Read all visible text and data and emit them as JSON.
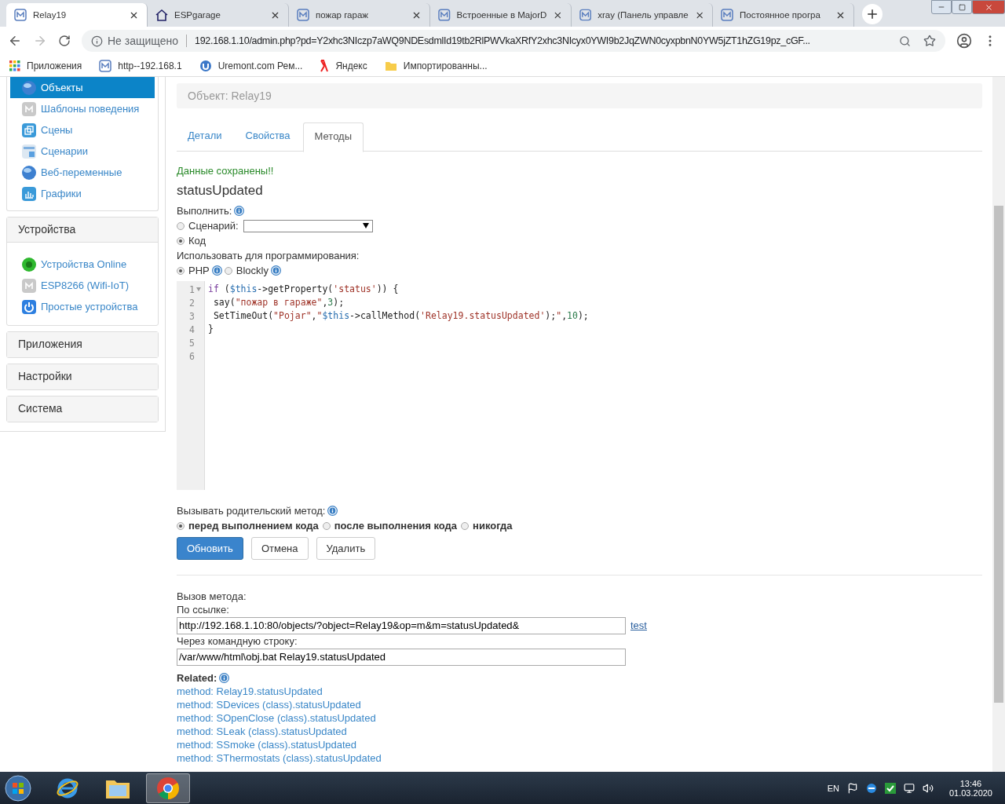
{
  "browser": {
    "tabs": [
      {
        "title": "Relay19",
        "kind": "m",
        "selected": true
      },
      {
        "title": "ESPgarage",
        "kind": "home",
        "selected": false
      },
      {
        "title": "пожар гараж",
        "kind": "m",
        "selected": false
      },
      {
        "title": "Встроенные в MajorD",
        "kind": "m",
        "selected": false
      },
      {
        "title": "xray (Панель управле",
        "kind": "m",
        "selected": false
      },
      {
        "title": "Постоянное програ",
        "kind": "m",
        "selected": false
      }
    ],
    "security": "Не защищено",
    "url": "192.168.1.10/admin.php?pd=Y2xhc3NIczp7aWQ9NDEsdmlId19tb2RlPWVkaXRfY2xhc3NIcyx0YWI9b2JqZWN0cyxpbnN0YW5jZT1hZG19pz_cGF...",
    "bookmarks": [
      {
        "label": "Приложения",
        "kind": "apps"
      },
      {
        "label": "http--192.168.1",
        "kind": "m"
      },
      {
        "label": "Uremont.com  Рем...",
        "kind": "uremont"
      },
      {
        "label": "Яндекс",
        "kind": "yandex"
      },
      {
        "label": "Импортированны...",
        "kind": "folder"
      }
    ]
  },
  "sidebar": {
    "items": [
      {
        "label": "Объекты",
        "kind": "globe",
        "selected": true
      },
      {
        "label": "Шаблоны поведения",
        "kind": "template",
        "selected": false
      },
      {
        "label": "Сцены",
        "kind": "scenes",
        "selected": false
      },
      {
        "label": "Сценарии",
        "kind": "scripts",
        "selected": false
      },
      {
        "label": "Веб-переменные",
        "kind": "globe",
        "selected": false
      },
      {
        "label": "Графики",
        "kind": "charts",
        "selected": false
      }
    ],
    "sections": [
      {
        "title": "Устройства",
        "items": [
          {
            "label": "Устройства Online",
            "kind": "online",
            "selected": false
          },
          {
            "label": "ESP8266 (Wifi-IoT)",
            "kind": "template",
            "selected": false
          },
          {
            "label": "Простые устройства",
            "kind": "power",
            "selected": false
          }
        ]
      },
      {
        "title": "Приложения"
      },
      {
        "title": "Настройки"
      },
      {
        "title": "Система"
      }
    ]
  },
  "main": {
    "object_label": "Объект: Relay19",
    "tabs": [
      {
        "label": "Детали",
        "selected": false
      },
      {
        "label": "Свойства",
        "selected": false
      },
      {
        "label": "Методы",
        "selected": true
      }
    ],
    "message": "Данные сохранены!!",
    "method_name": "statusUpdated",
    "execute_label": "Выполнить:",
    "execute_options": [
      {
        "label": "Сценарий:",
        "kind": "select",
        "selected": false
      },
      {
        "label": "Код",
        "kind": "plain",
        "selected": true
      }
    ],
    "programming_label": "Использовать для программирования:",
    "languages": [
      {
        "label": "PHP",
        "selected": true
      },
      {
        "label": "Blockly",
        "selected": false
      }
    ],
    "code": [
      {
        "number": "1",
        "foldable": true,
        "tokens": [
          {
            "kind": "kw",
            "t": "if"
          },
          {
            "kind": "p",
            "t": " ("
          },
          {
            "kind": "var",
            "t": "$this"
          },
          {
            "kind": "p",
            "t": "->getProperty("
          },
          {
            "kind": "str",
            "t": "'status'"
          },
          {
            "kind": "p",
            "t": ")) {"
          }
        ]
      },
      {
        "number": "2",
        "foldable": false,
        "tokens": [
          {
            "kind": "p",
            "t": " say("
          },
          {
            "kind": "str",
            "t": "\"пожар в гараже\""
          },
          {
            "kind": "p",
            "t": ","
          },
          {
            "kind": "num",
            "t": "3"
          },
          {
            "kind": "p",
            "t": ");"
          }
        ]
      },
      {
        "number": "3",
        "foldable": false,
        "tokens": [
          {
            "kind": "p",
            "t": " SetTimeOut("
          },
          {
            "kind": "str",
            "t": "\"Pojar\""
          },
          {
            "kind": "p",
            "t": ","
          },
          {
            "kind": "str",
            "t": "\""
          },
          {
            "kind": "var",
            "t": "$this"
          },
          {
            "kind": "p",
            "t": "->callMethod("
          },
          {
            "kind": "str",
            "t": "'Relay19.statusUpdated'"
          },
          {
            "kind": "p",
            "t": ");"
          },
          {
            "kind": "str",
            "t": "\""
          },
          {
            "kind": "p",
            "t": ","
          },
          {
            "kind": "num",
            "t": "10"
          },
          {
            "kind": "p",
            "t": ");"
          }
        ]
      },
      {
        "number": "4",
        "foldable": false,
        "tokens": [
          {
            "kind": "p",
            "t": "}"
          }
        ]
      },
      {
        "number": "5",
        "foldable": false
      },
      {
        "number": "6",
        "foldable": false
      }
    ],
    "parent_label": "Вызывать родительский метод:",
    "parent_options": [
      {
        "label": "перед выполнением кода",
        "selected": true
      },
      {
        "label": "после выполнения кода",
        "selected": false
      },
      {
        "label": "никогда",
        "selected": false
      }
    ],
    "buttons": [
      {
        "label": "Обновить",
        "kind": "primary"
      },
      {
        "label": "Отмена",
        "kind": "default"
      },
      {
        "label": "Удалить",
        "kind": "default"
      }
    ],
    "call_label": "Вызов метода:",
    "link_label": "По ссылке:",
    "link_value": "http://192.168.1.10:80/objects/?object=Relay19&op=m&m=statusUpdated&",
    "test_link": "test",
    "cli_label": "Через командную строку:",
    "cli_value": "/var/www/html\\obj.bat Relay19.statusUpdated",
    "related_label": "Related:",
    "related": [
      "method: Relay19.statusUpdated",
      "method: SDevices (class).statusUpdated",
      "method: SOpenClose (class).statusUpdated",
      "method: SLeak (class).statusUpdated",
      "method: SSmoke (class).statusUpdated",
      "method: SThermostats (class).statusUpdated"
    ]
  },
  "taskbar": {
    "apps": [
      {
        "kind": "ie",
        "selected": false
      },
      {
        "kind": "explorer",
        "selected": false
      },
      {
        "kind": "chrome",
        "selected": true
      }
    ],
    "language": "EN",
    "time": "13:46",
    "date": "01.03.2020"
  }
}
